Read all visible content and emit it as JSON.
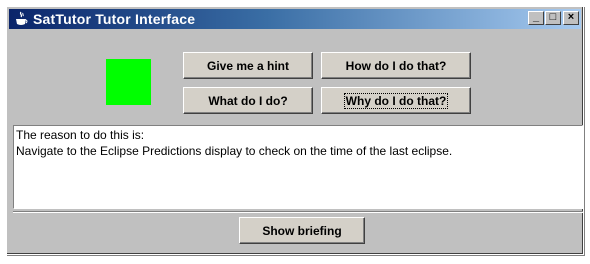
{
  "window": {
    "title": "SatTutor Tutor Interface",
    "icon": "java-cup-icon",
    "controls": {
      "minimize": "_",
      "maximize": "□",
      "close": "×"
    }
  },
  "status_indicator": {
    "color": "#00ff00"
  },
  "buttons": {
    "hint": "Give me a hint",
    "how": "How do I do that?",
    "what": "What do I do?",
    "why": "Why do I do that?",
    "briefing": "Show briefing"
  },
  "message": {
    "line1": "The reason to do this is:",
    "line2": "Navigate to the Eclipse Predictions display to check on the time of the last eclipse."
  },
  "colors": {
    "window_bg": "#c0c0c0",
    "title_gradient_start": "#0a246a",
    "title_gradient_end": "#a6caf0",
    "status_green": "#00ff00"
  }
}
